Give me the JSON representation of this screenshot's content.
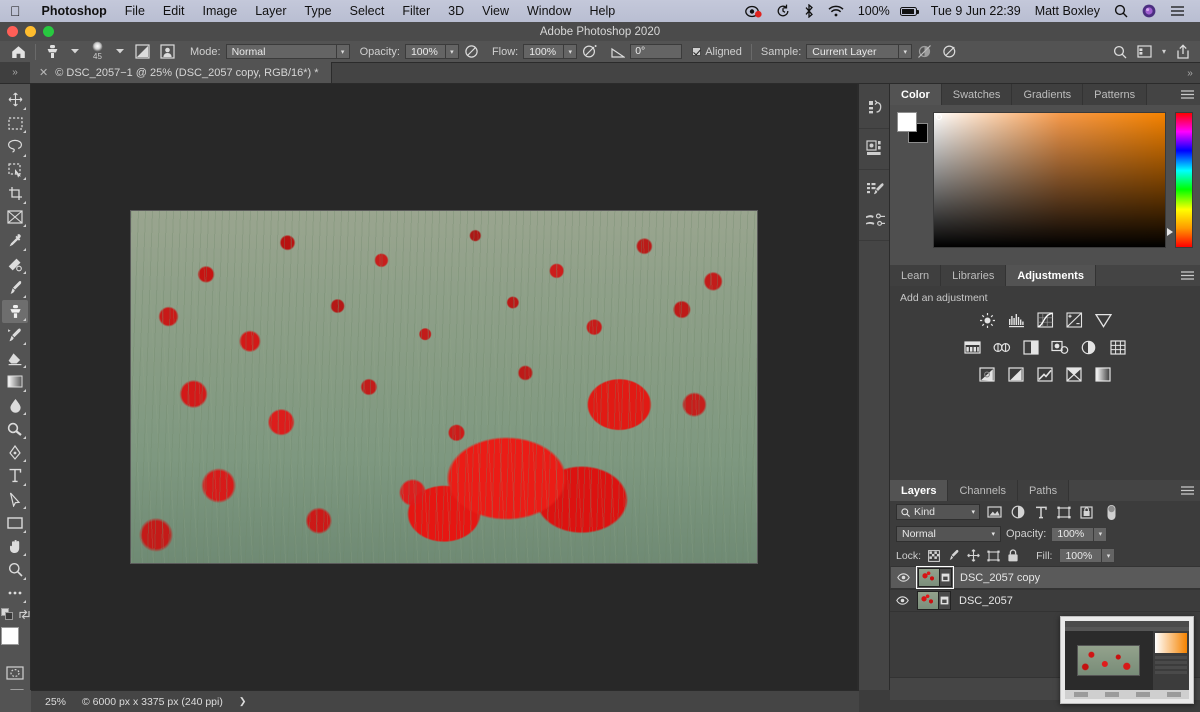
{
  "macbar": {
    "apple_icon": "apple-icon",
    "app_name": "Photoshop",
    "menus": [
      "File",
      "Edit",
      "Image",
      "Layer",
      "Type",
      "Select",
      "Filter",
      "3D",
      "View",
      "Window",
      "Help"
    ],
    "status_icons": [
      "screen-record-icon",
      "time-machine-icon",
      "bluetooth-icon",
      "wifi-icon"
    ],
    "battery_percent": "100%",
    "battery_icon": "battery-charging-icon",
    "datetime": "Tue 9 Jun  22:39",
    "user": "Matt Boxley",
    "search_icon": "spotlight-search-icon",
    "siri_icon": "siri-icon",
    "control_center_icon": "control-center-icon"
  },
  "window": {
    "title": "Adobe Photoshop 2020",
    "close_color": "#ff5f57",
    "minimize_color": "#ffbd2e",
    "zoom_color": "#28c940"
  },
  "options_bar": {
    "home_icon": "home-icon",
    "tool_icon": "clone-stamp-icon",
    "brush_size": "45",
    "brush_preset_icon": "brush-preset-icon",
    "toggle_brush_panel_icon": "toggle-brush-panel-icon",
    "toggle_clone_source_icon": "toggle-clone-source-icon",
    "mode_label": "Mode:",
    "mode_value": "Normal",
    "opacity_label": "Opacity:",
    "opacity_value": "100%",
    "pressure_opacity_icon": "pressure-opacity-icon",
    "flow_label": "Flow:",
    "flow_value": "100%",
    "airbrush_icon": "airbrush-icon",
    "smoothing_icon": "angle-icon",
    "angle_value": "0°",
    "aligned_label": "Aligned",
    "aligned_checked": true,
    "sample_label": "Sample:",
    "sample_value": "Current Layer",
    "ignore_adjustment_icon": "ignore-adjustment-layers-icon",
    "tablet_pressure_icon": "tablet-pressure-size-icon",
    "right_search_icon": "search-icon",
    "workspace_icon": "workspace-icon",
    "workspace_caret": "chevron-down-icon",
    "share_icon": "share-icon"
  },
  "tab_bar": {
    "left_grip": "»",
    "close_icon": "close-icon",
    "doc_title": "© DSC_2057−1 @ 25% (DSC_2057 copy, RGB/16*) *",
    "right_grip": "»"
  },
  "tools": [
    {
      "name": "move-tool",
      "glyph": "move"
    },
    {
      "name": "rectangular-marquee-tool",
      "glyph": "marquee"
    },
    {
      "name": "lasso-tool",
      "glyph": "lasso"
    },
    {
      "name": "object-selection-tool",
      "glyph": "objectsel"
    },
    {
      "name": "crop-tool",
      "glyph": "crop"
    },
    {
      "name": "frame-tool",
      "glyph": "frame"
    },
    {
      "name": "eyedropper-tool",
      "glyph": "eyedropper"
    },
    {
      "name": "spot-healing-brush-tool",
      "glyph": "healing"
    },
    {
      "name": "brush-tool",
      "glyph": "brush"
    },
    {
      "name": "clone-stamp-tool",
      "glyph": "stamp",
      "active": true
    },
    {
      "name": "history-brush-tool",
      "glyph": "historybrush"
    },
    {
      "name": "eraser-tool",
      "glyph": "eraser"
    },
    {
      "name": "gradient-tool",
      "glyph": "gradient"
    },
    {
      "name": "blur-tool",
      "glyph": "blur"
    },
    {
      "name": "dodge-tool",
      "glyph": "dodge"
    },
    {
      "name": "pen-tool",
      "glyph": "pen"
    },
    {
      "name": "type-tool",
      "glyph": "type"
    },
    {
      "name": "path-selection-tool",
      "glyph": "pathsel"
    },
    {
      "name": "rectangle-tool",
      "glyph": "rect"
    },
    {
      "name": "hand-tool",
      "glyph": "hand"
    },
    {
      "name": "zoom-tool",
      "glyph": "zoom"
    },
    {
      "name": "edit-toolbar-button",
      "glyph": "dots"
    }
  ],
  "tool_footer": {
    "default_colors_icon": "default-colors-icon",
    "swap_colors_icon": "swap-colors-icon",
    "foreground_color": "#ffffff",
    "background_color": "#000000",
    "quick_mask_icon": "quick-mask-icon",
    "screen_mode_icon": "screen-mode-icon"
  },
  "icon_dock": [
    {
      "name": "history-panel-icon"
    },
    {
      "name": "properties-panel-icon"
    },
    {
      "name": "brush-settings-panel-icon"
    },
    {
      "name": "brushes-panel-icon"
    }
  ],
  "color_panel": {
    "tabs": [
      {
        "label": "Color",
        "active": true
      },
      {
        "label": "Swatches",
        "active": false
      },
      {
        "label": "Gradients",
        "active": false
      },
      {
        "label": "Patterns",
        "active": false
      }
    ],
    "menu_icon": "panel-menu-icon",
    "foreground": "#ffffff",
    "background": "#000000",
    "picker_accent": "#f58300",
    "picker_icon": "color-field",
    "hue_slider_icon": "hue-slider"
  },
  "adjustments_panel": {
    "tabs": [
      {
        "label": "Learn",
        "active": false
      },
      {
        "label": "Libraries",
        "active": false
      },
      {
        "label": "Adjustments",
        "active": true
      }
    ],
    "menu_icon": "panel-menu-icon",
    "heading": "Add an adjustment",
    "rows": [
      [
        {
          "name": "brightness-contrast-adjustment-icon"
        },
        {
          "name": "levels-adjustment-icon"
        },
        {
          "name": "curves-adjustment-icon"
        },
        {
          "name": "exposure-adjustment-icon"
        },
        {
          "name": "vibrance-adjustment-icon"
        }
      ],
      [
        {
          "name": "hue-saturation-adjustment-icon"
        },
        {
          "name": "color-balance-adjustment-icon"
        },
        {
          "name": "black-white-adjustment-icon"
        },
        {
          "name": "photo-filter-adjustment-icon"
        },
        {
          "name": "channel-mixer-adjustment-icon"
        },
        {
          "name": "color-lookup-adjustment-icon"
        }
      ],
      [
        {
          "name": "invert-adjustment-icon"
        },
        {
          "name": "posterize-adjustment-icon"
        },
        {
          "name": "threshold-adjustment-icon"
        },
        {
          "name": "selective-color-adjustment-icon"
        },
        {
          "name": "gradient-map-adjustment-icon"
        }
      ]
    ]
  },
  "layers_panel": {
    "tabs": [
      {
        "label": "Layers",
        "active": true
      },
      {
        "label": "Channels",
        "active": false
      },
      {
        "label": "Paths",
        "active": false
      }
    ],
    "menu_icon": "panel-menu-icon",
    "filter_label": "Kind",
    "filter_search_icon": "search-icon",
    "filter_icons": [
      {
        "name": "filter-pixel-layers-icon"
      },
      {
        "name": "filter-adjustment-layers-icon"
      },
      {
        "name": "filter-type-layers-icon"
      },
      {
        "name": "filter-shape-layers-icon"
      },
      {
        "name": "filter-smart-objects-icon"
      }
    ],
    "filter_toggle_icon": "filter-toggle-switch",
    "blend_mode": "Normal",
    "opacity_label": "Opacity:",
    "opacity_value": "100%",
    "lock_label": "Lock:",
    "lock_icons": [
      {
        "name": "lock-transparent-pixels-icon"
      },
      {
        "name": "lock-image-pixels-icon"
      },
      {
        "name": "lock-position-icon"
      },
      {
        "name": "lock-artboard-nesting-icon"
      },
      {
        "name": "lock-all-icon"
      }
    ],
    "fill_label": "Fill:",
    "fill_value": "100%",
    "layers": [
      {
        "name": "DSC_2057 copy",
        "visible": true,
        "selected": true,
        "visibility_icon": "eye-icon",
        "link_icon": "smart-object-badge-icon"
      },
      {
        "name": "DSC_2057",
        "visible": true,
        "selected": false,
        "visibility_icon": "eye-icon",
        "link_icon": "smart-object-badge-icon"
      }
    ],
    "footer_icons": [
      {
        "name": "link-layers-icon",
        "glyph": "link"
      },
      {
        "name": "layer-styles-fx-icon",
        "glyph": "fx"
      }
    ]
  },
  "status_bar": {
    "zoom": "25%",
    "doc_info": "© 6000 px x 3375 px (240 ppi)",
    "expand_icon": "chevron-right-icon"
  },
  "screenshot_overlay": {
    "name": "screenshot-thumbnail-preview"
  }
}
